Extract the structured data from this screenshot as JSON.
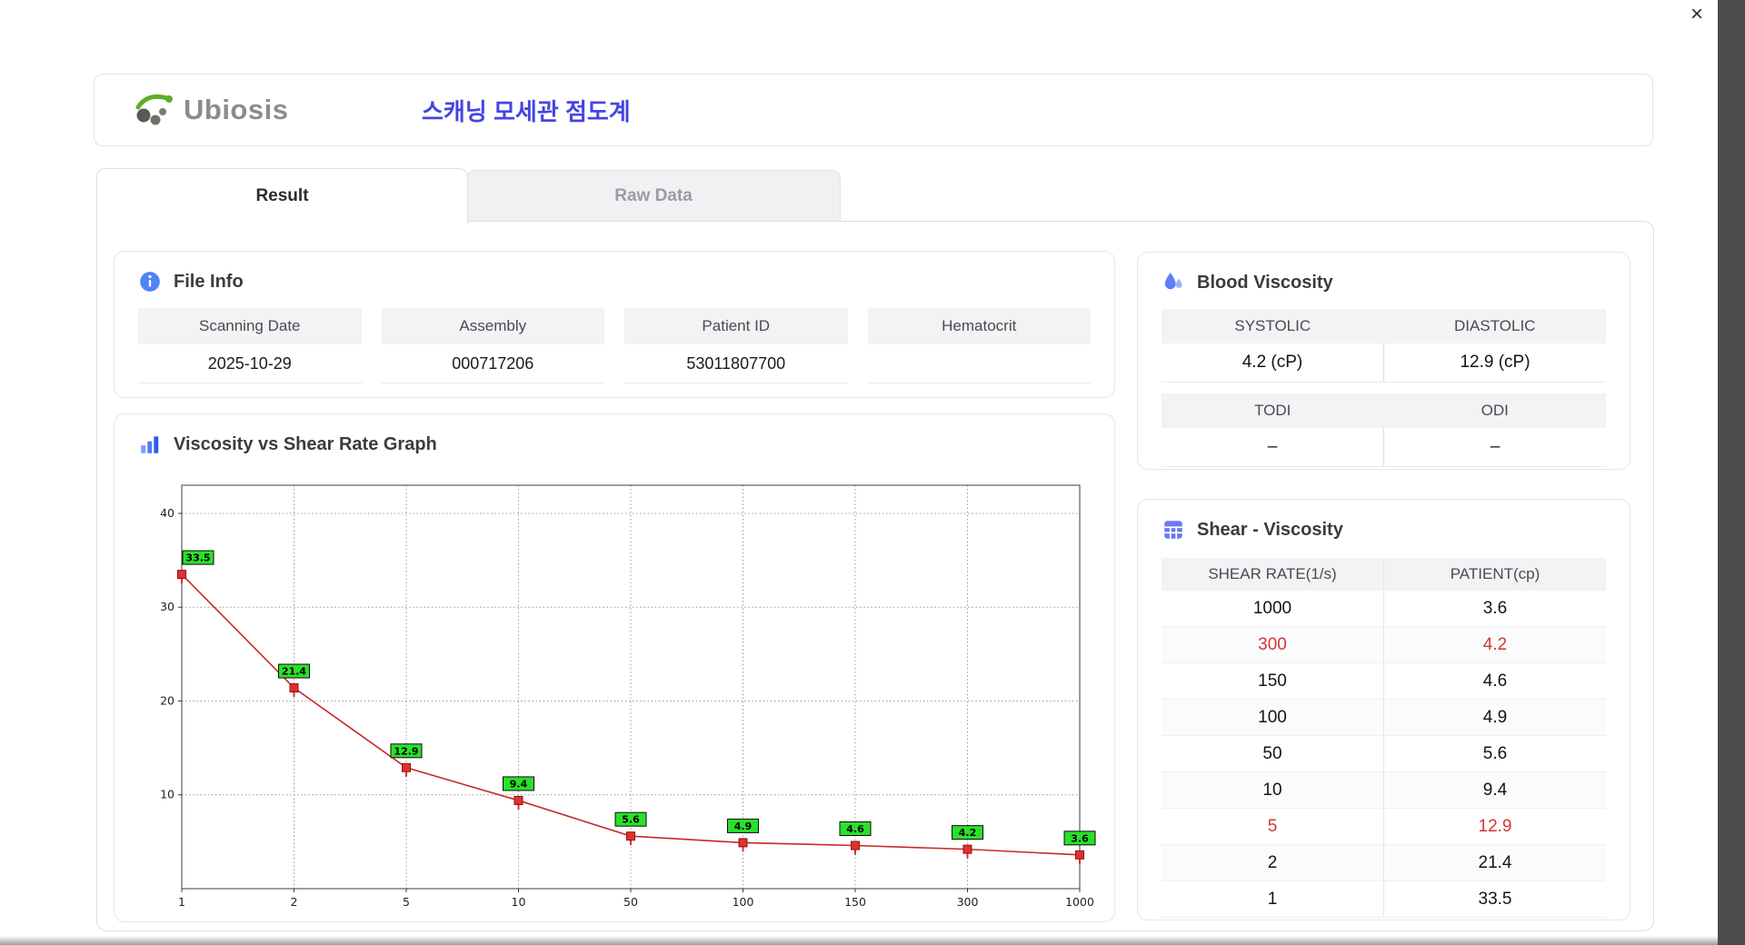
{
  "window": {
    "close_label": "×"
  },
  "header": {
    "logo_text": "Ubiosis",
    "title": "스캐닝 모세관 점도계"
  },
  "tabs": [
    {
      "label": "Result",
      "active": true
    },
    {
      "label": "Raw Data",
      "active": false
    }
  ],
  "file_info": {
    "title": "File Info",
    "fields": [
      {
        "label": "Scanning Date",
        "value": "2025-10-29"
      },
      {
        "label": "Assembly",
        "value": "000717206"
      },
      {
        "label": "Patient ID",
        "value": "53011807700"
      },
      {
        "label": "Hematocrit",
        "value": ""
      }
    ]
  },
  "graph": {
    "title": "Viscosity vs Shear Rate Graph"
  },
  "blood_viscosity": {
    "title": "Blood Viscosity",
    "pairs": [
      {
        "headers": [
          "SYSTOLIC",
          "DIASTOLIC"
        ],
        "values": [
          "4.2 (cP)",
          "12.9 (cP)"
        ]
      },
      {
        "headers": [
          "TODI",
          "ODI"
        ],
        "values": [
          "–",
          "–"
        ]
      }
    ]
  },
  "shear_viscosity": {
    "title": "Shear - Viscosity",
    "columns": [
      "SHEAR RATE(1/s)",
      "PATIENT(cp)"
    ],
    "rows": [
      {
        "shear": "1000",
        "patient": "3.6",
        "highlight": false
      },
      {
        "shear": "300",
        "patient": "4.2",
        "highlight": true
      },
      {
        "shear": "150",
        "patient": "4.6",
        "highlight": false
      },
      {
        "shear": "100",
        "patient": "4.9",
        "highlight": false
      },
      {
        "shear": "50",
        "patient": "5.6",
        "highlight": false
      },
      {
        "shear": "10",
        "patient": "9.4",
        "highlight": false
      },
      {
        "shear": "5",
        "patient": "12.9",
        "highlight": true
      },
      {
        "shear": "2",
        "patient": "21.4",
        "highlight": false
      },
      {
        "shear": "1",
        "patient": "33.5",
        "highlight": false
      }
    ]
  },
  "chart_data": {
    "type": "line",
    "title": "Viscosity vs Shear Rate Graph",
    "x_ticks": [
      "1",
      "2",
      "5",
      "10",
      "50",
      "100",
      "150",
      "300",
      "1000"
    ],
    "values": [
      33.5,
      21.4,
      12.9,
      9.4,
      5.6,
      4.9,
      4.6,
      4.2,
      3.6
    ],
    "y_ticks": [
      10,
      20,
      30,
      40
    ],
    "ylim": [
      0,
      43
    ],
    "x_scale": "categorical-evenly-spaced",
    "grid": true,
    "xlabel": "",
    "ylabel": "",
    "legend": "none",
    "line_color": "#c62828",
    "marker_color": "#e03030",
    "point_label_bg": "#2be02b"
  },
  "colors": {
    "accent_blue": "#4f83f7",
    "title_blue": "#4545e2",
    "highlight_red": "#d43535"
  }
}
